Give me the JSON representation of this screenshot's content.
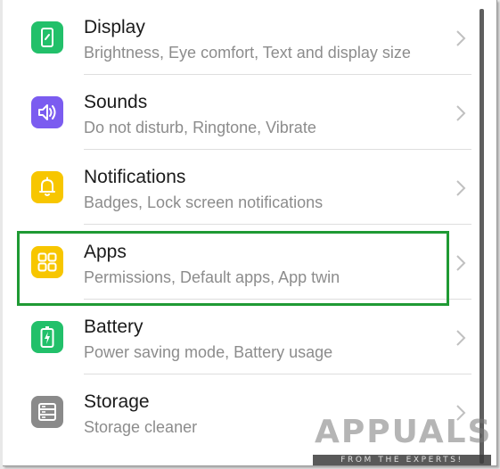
{
  "settings": {
    "items": [
      {
        "title": "Display",
        "subtitle": "Brightness, Eye comfort, Text and display size",
        "icon": "display-icon",
        "color": "#22c06a"
      },
      {
        "title": "Sounds",
        "subtitle": "Do not disturb, Ringtone, Vibrate",
        "icon": "speaker-icon",
        "color": "#7b5cf0"
      },
      {
        "title": "Notifications",
        "subtitle": "Badges, Lock screen notifications",
        "icon": "bell-icon",
        "color": "#f7c600"
      },
      {
        "title": "Apps",
        "subtitle": "Permissions, Default apps, App twin",
        "icon": "apps-grid-icon",
        "color": "#f7c600",
        "highlighted": true
      },
      {
        "title": "Battery",
        "subtitle": "Power saving mode, Battery usage",
        "icon": "battery-icon",
        "color": "#22c06a"
      },
      {
        "title": "Storage",
        "subtitle": "Storage cleaner",
        "icon": "storage-icon",
        "color": "#8a8a8a"
      }
    ]
  },
  "watermark": {
    "text": "APPUALS",
    "tagline": "FROM THE EXPERTS!"
  },
  "colors": {
    "highlight": "#1f9a34",
    "title_text": "#1b1b1b",
    "subtitle_text": "#8c8c8c",
    "chevron": "#c0c0c0"
  }
}
